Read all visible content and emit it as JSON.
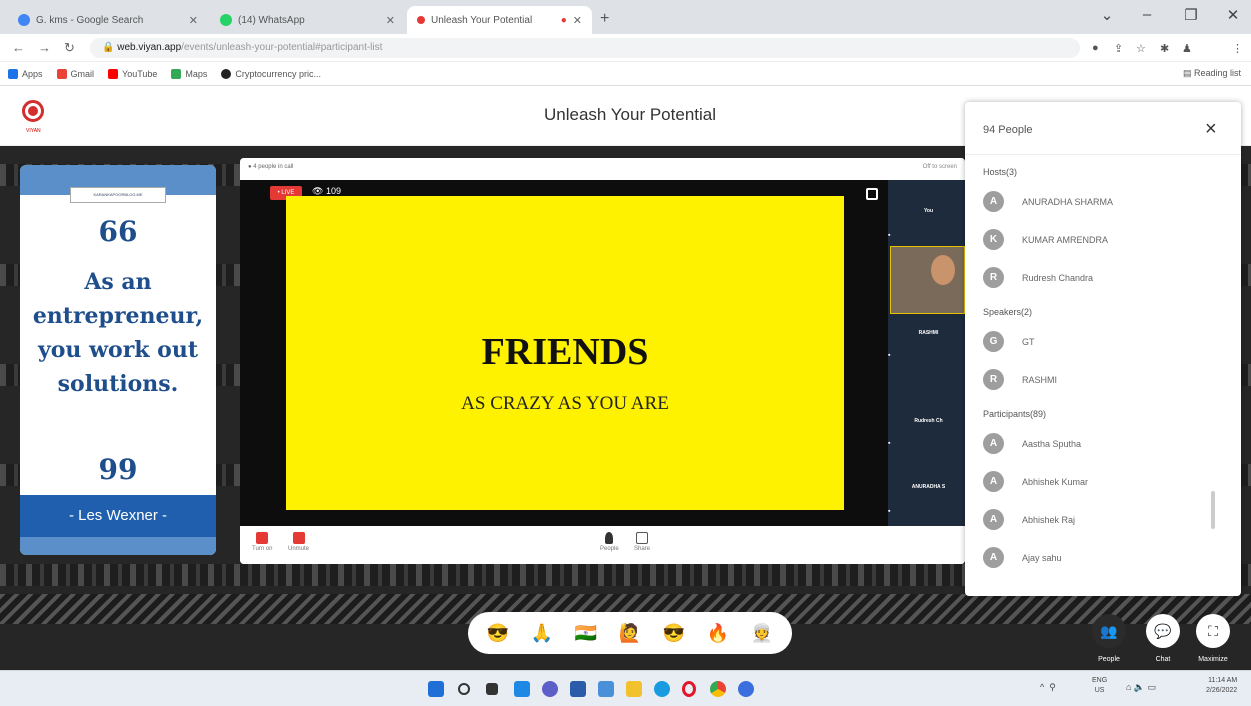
{
  "browser": {
    "tabs": [
      {
        "title": "G. kms - Google Search",
        "color": "#4285f4"
      },
      {
        "title": "(14) WhatsApp",
        "color": "#25d366"
      },
      {
        "title": "Unleash Your Potential",
        "color": "#e53935"
      }
    ],
    "new_tab": "+",
    "url_host": "web.viyan.app",
    "url_path": "/events/unleash-your-potential#participant-list",
    "bookmarks": [
      {
        "label": "Apps",
        "color": "#1a73e8"
      },
      {
        "label": "Gmail",
        "color": "#ea4335"
      },
      {
        "label": "YouTube",
        "color": "#ff0000"
      },
      {
        "label": "Maps",
        "color": "#34a853"
      },
      {
        "label": "Cryptocurrency pric...",
        "color": "#222222"
      }
    ],
    "reading_list": "Reading list"
  },
  "app": {
    "logo_text": "VIYAN",
    "title": "Unleash Your Potential"
  },
  "quote_card": {
    "tag": "KARANKAPOORBLOG.ME",
    "open_quote": "66",
    "quote": "As an entrepreneur, you work out solutions.",
    "close_quote": "99",
    "author": "- Les Wexner -"
  },
  "video": {
    "topbar_left": "4 people in call",
    "topbar_right": "Off to screen",
    "live": "• LIVE",
    "viewers": "109",
    "slide_title": "FRIENDS",
    "slide_subtitle": "AS CRAZY AS YOU ARE",
    "tiles": [
      "You",
      "RASHMI",
      "Rudresh Ch",
      "ANURADHA S"
    ],
    "controls": {
      "turn_on": "Turn on",
      "unmute": "Unmute",
      "people": "People",
      "share": "Share"
    }
  },
  "people_panel": {
    "title": "94 People",
    "close": "×",
    "sections": [
      {
        "label": "Hosts(3)",
        "people": [
          {
            "initial": "A",
            "name": "ANURADHA SHARMA"
          },
          {
            "initial": "K",
            "name": "KUMAR AMRENDRA"
          },
          {
            "initial": "R",
            "name": "Rudresh Chandra"
          }
        ]
      },
      {
        "label": "Speakers(2)",
        "people": [
          {
            "initial": "G",
            "name": "GT"
          },
          {
            "initial": "R",
            "name": "RASHMI"
          }
        ]
      },
      {
        "label": "Participants(89)",
        "people": [
          {
            "initial": "A",
            "name": "Aastha Sputha"
          },
          {
            "initial": "A",
            "name": "Abhishek Kumar"
          },
          {
            "initial": "A",
            "name": "Abhishek Raj"
          },
          {
            "initial": "A",
            "name": "Ajay sahu"
          }
        ]
      }
    ]
  },
  "reactions": [
    "😎",
    "🙏",
    "🇮🇳",
    "🙋",
    "😎",
    "🔥",
    "👳"
  ],
  "bottom_controls": {
    "people": "People",
    "chat": "Chat",
    "maximize": "Maximize"
  },
  "taskbar": {
    "lang_1": "ENG",
    "lang_2": "US",
    "time": "11:14 AM",
    "date": "2/26/2022"
  }
}
